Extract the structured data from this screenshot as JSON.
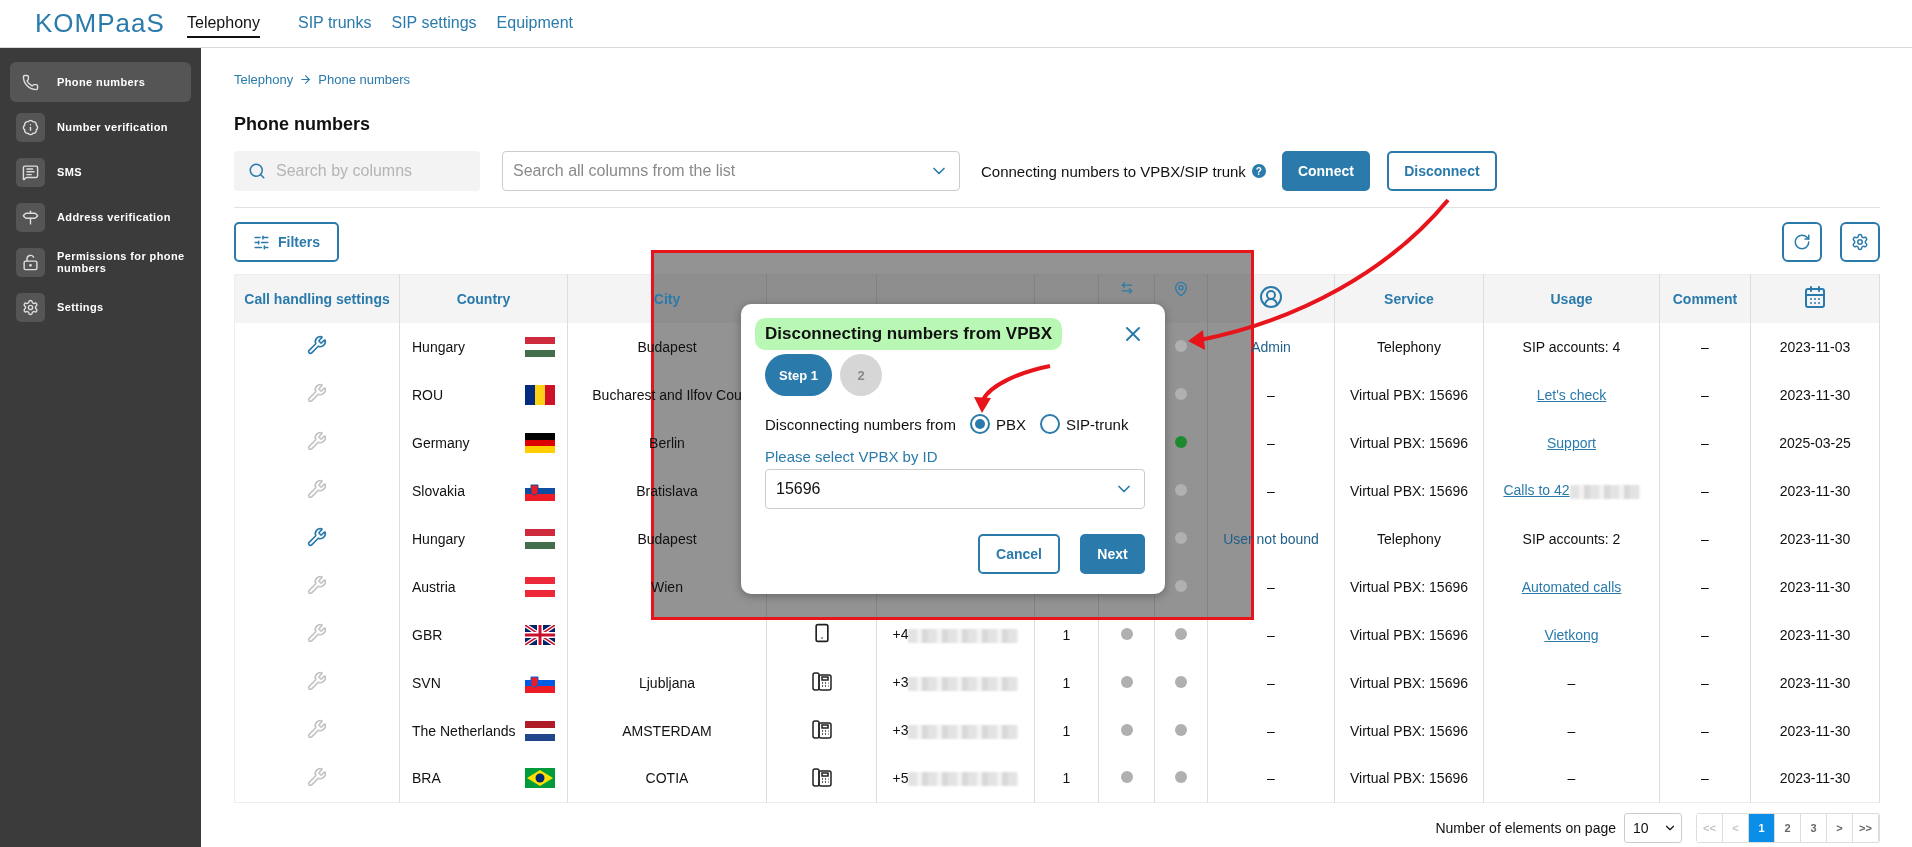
{
  "logo": "KOMPaaS",
  "nav": [
    {
      "label": "Telephony",
      "selected": true
    },
    {
      "label": "SIP trunks",
      "selected": false
    },
    {
      "label": "SIP settings",
      "selected": false
    },
    {
      "label": "Equipment",
      "selected": false
    }
  ],
  "sidebar": {
    "items": [
      {
        "label": "Phone numbers",
        "selected": true
      },
      {
        "label": "Number verification",
        "selected": false
      },
      {
        "label": "SMS",
        "selected": false
      },
      {
        "label": "Address verification",
        "selected": false
      },
      {
        "label": "Permissions for phone numbers",
        "selected": false
      },
      {
        "label": "Settings",
        "selected": false
      }
    ]
  },
  "breadcrumb": [
    "Telephony",
    "Phone numbers"
  ],
  "title": "Phone numbers",
  "toolbar": {
    "search": {
      "placeholder": "Search by columns"
    },
    "column_select": {
      "placeholder": "Search all columns from the list"
    },
    "connect_label": "Connecting numbers to VPBX/SIP trunk",
    "help": "?",
    "connect": "Connect",
    "disconnect": "Disconnect"
  },
  "filters": "Filters",
  "table": {
    "columns": {
      "settings": "Call handling settings",
      "country": "Country",
      "city": "City",
      "service": "Service",
      "usage": "Usage",
      "comment": "Comment"
    },
    "rows": [
      {
        "settings_enabled": true,
        "country": "Hungary",
        "flag": {
          "kind": "horizontal",
          "stripes": [
            {
              "color": "#cd2a3e"
            },
            {
              "color": "#ffffff"
            },
            {
              "color": "#436f4d"
            }
          ]
        },
        "city": "Budapest",
        "dot2": {
          "color": "#b0b0b0"
        },
        "user": {
          "text": "Admin",
          "kind": "link"
        },
        "service": "Telephony",
        "usage": {
          "text": "SIP accounts: 4",
          "kind": "text"
        },
        "comment": "–",
        "date": "2023-11-03"
      },
      {
        "settings_enabled": false,
        "country": "ROU",
        "flag": {
          "kind": "vertical",
          "stripes": [
            {
              "color": "#002b7f"
            },
            {
              "color": "#fcd116"
            },
            {
              "color": "#ce1126"
            }
          ]
        },
        "city": "Bucharest and Ilfov Cou",
        "dot2": {
          "color": "#b0b0b0"
        },
        "user": {
          "text": "–",
          "kind": "text"
        },
        "service": "Virtual PBX: 15696",
        "usage": {
          "text": "Let's check",
          "kind": "link"
        },
        "comment": "–",
        "date": "2023-11-30"
      },
      {
        "settings_enabled": false,
        "country": "Germany",
        "flag": {
          "kind": "horizontal",
          "stripes": [
            {
              "color": "#000000"
            },
            {
              "color": "#dd0000"
            },
            {
              "color": "#ffce00"
            }
          ]
        },
        "city": "Berlin",
        "dot2": {
          "color": "#1e8a2e"
        },
        "user": {
          "text": "–",
          "kind": "text"
        },
        "service": "Virtual PBX: 15696",
        "usage": {
          "text": "Support",
          "kind": "link"
        },
        "comment": "–",
        "date": "2025-03-25"
      },
      {
        "settings_enabled": false,
        "country": "Slovakia",
        "flag": {
          "kind": "horizontal-emblem",
          "stripes": [
            {
              "color": "#ffffff"
            },
            {
              "color": "#0b4ea2"
            },
            {
              "color": "#ee1c25"
            }
          ]
        },
        "city": "Bratislava",
        "dot2": {
          "color": "#b0b0b0"
        },
        "user": {
          "text": "–",
          "kind": "text"
        },
        "service": "Virtual PBX: 15696",
        "usage": {
          "text": "Calls to 42",
          "kind": "link",
          "redacted": true
        },
        "comment": "–",
        "date": "2023-11-30"
      },
      {
        "settings_enabled": true,
        "country": "Hungary",
        "flag": {
          "kind": "horizontal",
          "stripes": [
            {
              "color": "#cd2a3e"
            },
            {
              "color": "#ffffff"
            },
            {
              "color": "#436f4d"
            }
          ]
        },
        "city": "Budapest",
        "dot2": {
          "color": "#b0b0b0"
        },
        "user": {
          "text": "User not bound",
          "kind": "link"
        },
        "service": "Telephony",
        "usage": {
          "text": "SIP accounts: 2",
          "kind": "text"
        },
        "comment": "–",
        "date": "2023-11-30"
      },
      {
        "settings_enabled": false,
        "country": "Austria",
        "flag": {
          "kind": "horizontal",
          "stripes": [
            {
              "color": "#ed2939"
            },
            {
              "color": "#ffffff"
            },
            {
              "color": "#ed2939"
            }
          ]
        },
        "city": "Wien",
        "dot2": {
          "color": "#b0b0b0"
        },
        "user": {
          "text": "–",
          "kind": "text"
        },
        "service": "Virtual PBX: 15696",
        "usage": {
          "text": "Automated calls",
          "kind": "link"
        },
        "comment": "–",
        "date": "2023-11-30"
      },
      {
        "settings_enabled": false,
        "country": "GBR",
        "flag": {
          "kind": "union",
          "stripes": [
            {
              "color": "#012169"
            },
            {
              "color": "#ffffff"
            },
            {
              "color": "#c8102e"
            }
          ]
        },
        "kind": "mobile",
        "number": "+4",
        "count": "1",
        "dot1": {
          "color": "#b0b0b0"
        },
        "dot2": {
          "color": "#b0b0b0"
        },
        "user": {
          "text": "–",
          "kind": "text"
        },
        "service": "Virtual PBX: 15696",
        "usage": {
          "text": "Vietkong",
          "kind": "link"
        },
        "comment": "–",
        "date": "2023-11-30"
      },
      {
        "settings_enabled": false,
        "country": "SVN",
        "flag": {
          "kind": "horizontal-emblem",
          "stripes": [
            {
              "color": "#ffffff"
            },
            {
              "color": "#005ce5"
            },
            {
              "color": "#ed1c24"
            }
          ]
        },
        "city": "Ljubljana",
        "kind": "landline",
        "number": "+3",
        "count": "1",
        "dot1": {
          "color": "#b0b0b0"
        },
        "dot2": {
          "color": "#b0b0b0"
        },
        "user": {
          "text": "–",
          "kind": "text"
        },
        "service": "Virtual PBX: 15696",
        "usage": {
          "text": "–",
          "kind": "text"
        },
        "comment": "–",
        "date": "2023-11-30"
      },
      {
        "settings_enabled": false,
        "country": "The Netherlands",
        "flag": {
          "kind": "horizontal",
          "stripes": [
            {
              "color": "#ae1c28"
            },
            {
              "color": "#ffffff"
            },
            {
              "color": "#21468b"
            }
          ]
        },
        "city": "AMSTERDAM",
        "kind": "landline",
        "number": "+3",
        "count": "1",
        "dot1": {
          "color": "#b0b0b0"
        },
        "dot2": {
          "color": "#b0b0b0"
        },
        "user": {
          "text": "–",
          "kind": "text"
        },
        "service": "Virtual PBX: 15696",
        "usage": {
          "text": "–",
          "kind": "text"
        },
        "comment": "–",
        "date": "2023-11-30"
      },
      {
        "settings_enabled": false,
        "country": "BRA",
        "flag": {
          "kind": "diamond",
          "stripes": [
            {
              "color": "#009c3b"
            },
            {
              "color": "#ffdf00"
            },
            {
              "color": "#002776"
            }
          ]
        },
        "city": "COTIA",
        "kind": "landline",
        "number": "+5",
        "count": "1",
        "dot1": {
          "color": "#b0b0b0"
        },
        "dot2": {
          "color": "#b0b0b0"
        },
        "user": {
          "text": "–",
          "kind": "text"
        },
        "service": "Virtual PBX: 15696",
        "usage": {
          "text": "–",
          "kind": "text"
        },
        "comment": "–",
        "date": "2023-11-30"
      }
    ]
  },
  "pagination": {
    "label": "Number of elements on page",
    "page_size": "10",
    "pages": [
      {
        "label": "<<",
        "selected": false,
        "disabled": true
      },
      {
        "label": "<",
        "selected": false,
        "disabled": true
      },
      {
        "label": "1",
        "selected": true,
        "disabled": false
      },
      {
        "label": "2",
        "selected": false,
        "disabled": false
      },
      {
        "label": "3",
        "selected": false,
        "disabled": false
      },
      {
        "label": ">",
        "selected": false,
        "disabled": false
      },
      {
        "label": ">>",
        "selected": false,
        "disabled": false
      }
    ]
  },
  "dialog": {
    "title": "Disconnecting numbers from VPBX",
    "steps": [
      {
        "label": "Step 1",
        "selected": true
      },
      {
        "label": "2",
        "selected": false
      }
    ],
    "source_label": "Disconnecting numbers from",
    "options": [
      {
        "label": "PBX",
        "selected": true
      },
      {
        "label": "SIP-trunk",
        "selected": false
      }
    ],
    "select_label": "Please select VPBX by ID",
    "select_value": "15696",
    "cancel": "Cancel",
    "next": "Next"
  }
}
